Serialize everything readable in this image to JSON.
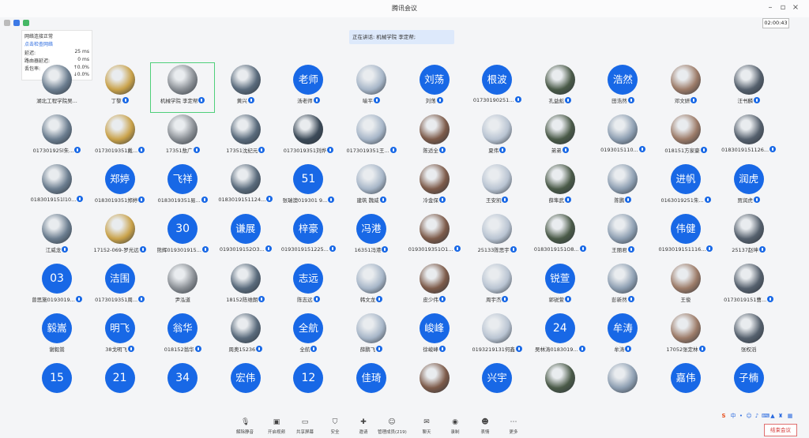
{
  "app": {
    "title": "腾讯会议"
  },
  "clock": "02:00:43",
  "speaking_banner": "正在讲话: 机械学院 李定帮;",
  "network": {
    "status": "网络连接正常",
    "check_link": "点击检查网络",
    "rows": [
      {
        "label": "延迟:",
        "value": "25 ms"
      },
      {
        "label": "路由器延迟:",
        "value": "0 ms"
      },
      {
        "label": "丢包率:",
        "value": "↑0.0%"
      },
      {
        "label": "",
        "value": "↓0.0%"
      }
    ]
  },
  "participants": [
    {
      "name": "湖北工程学院吴...",
      "avatar": "photo",
      "mic": false
    },
    {
      "name": "丁黎",
      "avatar": "photo",
      "mic": true
    },
    {
      "name": "机械学院 李定帮",
      "avatar": "photo",
      "mic": true,
      "active": true
    },
    {
      "name": "黄兴",
      "avatar": "photo",
      "mic": true
    },
    {
      "name": "汤老师",
      "avatar": "text",
      "text": "老师",
      "mic": true
    },
    {
      "name": "喻平",
      "avatar": "photo",
      "mic": true
    },
    {
      "name": "刘荡",
      "avatar": "text",
      "text": "刘荡",
      "mic": true
    },
    {
      "name": "01730190251...",
      "avatar": "text",
      "text": "根波",
      "mic": true
    },
    {
      "name": "孔益彪",
      "avatar": "photo",
      "mic": true
    },
    {
      "name": "田浩然",
      "avatar": "text",
      "text": "浩然",
      "mic": true
    },
    {
      "name": "邓文妍",
      "avatar": "photo",
      "mic": true
    },
    {
      "name": "汪书麟",
      "avatar": "photo",
      "mic": true
    },
    {
      "name": "017301925l朱...",
      "avatar": "photo",
      "mic": true
    },
    {
      "name": "0173019351戴...",
      "avatar": "photo",
      "mic": true
    },
    {
      "name": "17351敖广",
      "avatar": "photo",
      "mic": true
    },
    {
      "name": "17351沈纪元",
      "avatar": "photo",
      "mic": true
    },
    {
      "name": "0173019351刘烨",
      "avatar": "photo",
      "mic": true
    },
    {
      "name": "0173019351王...",
      "avatar": "photo",
      "mic": true
    },
    {
      "name": "陈适全",
      "avatar": "photo",
      "mic": true
    },
    {
      "name": "夏伟",
      "avatar": "photo",
      "mic": true
    },
    {
      "name": "弟弟",
      "avatar": "photo",
      "mic": true
    },
    {
      "name": "0193015110...",
      "avatar": "photo",
      "mic": true
    },
    {
      "name": "018151方家豪",
      "avatar": "photo",
      "mic": true
    },
    {
      "name": "0183019151126...",
      "avatar": "photo",
      "mic": true
    },
    {
      "name": "0183019151l10...",
      "avatar": "photo",
      "mic": true
    },
    {
      "name": "0183019351郑婷",
      "avatar": "text",
      "text": "郑婷",
      "mic": true
    },
    {
      "name": "0183019351易...",
      "avatar": "text",
      "text": "飞祥",
      "mic": true
    },
    {
      "name": "0183019151124...",
      "avatar": "photo",
      "mic": true
    },
    {
      "name": "张瑞澳019301 9...",
      "avatar": "text",
      "text": "51",
      "mic": true
    },
    {
      "name": "建筑 魏威",
      "avatar": "photo",
      "mic": true
    },
    {
      "name": "冷金保",
      "avatar": "photo",
      "mic": true
    },
    {
      "name": "王安凯",
      "avatar": "photo",
      "mic": true
    },
    {
      "name": "薛隼武",
      "avatar": "photo",
      "mic": true
    },
    {
      "name": "陈鹏",
      "avatar": "photo",
      "mic": true
    },
    {
      "name": "0163019251朱...",
      "avatar": "text",
      "text": "进帆",
      "mic": true
    },
    {
      "name": "贾润虎",
      "avatar": "text",
      "text": "润虎",
      "mic": true
    },
    {
      "name": "江威龙",
      "avatar": "photo",
      "mic": true
    },
    {
      "name": "17152-069-罗光远",
      "avatar": "photo",
      "mic": true
    },
    {
      "name": "熊辉019301915...",
      "avatar": "text",
      "text": "30",
      "mic": true
    },
    {
      "name": "0193019152O3...",
      "avatar": "text",
      "text": "谦展",
      "mic": true
    },
    {
      "name": "0193019151225...",
      "avatar": "text",
      "text": "梓豪",
      "mic": true
    },
    {
      "name": "16351冯港",
      "avatar": "text",
      "text": "冯港",
      "mic": true
    },
    {
      "name": "0193019351O1...",
      "avatar": "photo",
      "mic": true
    },
    {
      "name": "25133陈思宇",
      "avatar": "photo",
      "mic": true
    },
    {
      "name": "0183019151O8...",
      "avatar": "photo",
      "mic": true
    },
    {
      "name": "王丽君",
      "avatar": "photo",
      "mic": true
    },
    {
      "name": "0193019151116...",
      "avatar": "text",
      "text": "伟健",
      "mic": true
    },
    {
      "name": "25137赵坤",
      "avatar": "photo",
      "mic": true
    },
    {
      "name": "曾思施0193019...",
      "avatar": "text",
      "text": "03",
      "mic": true
    },
    {
      "name": "0173019351周...",
      "avatar": "text",
      "text": "洁围",
      "mic": true
    },
    {
      "name": "尹泓道",
      "avatar": "photo",
      "mic": false
    },
    {
      "name": "18152陈维朗",
      "avatar": "photo",
      "mic": true
    },
    {
      "name": "陈志远",
      "avatar": "text",
      "text": "志远",
      "mic": true
    },
    {
      "name": "韩文龙",
      "avatar": "photo",
      "mic": true
    },
    {
      "name": "皮少伟",
      "avatar": "photo",
      "mic": true
    },
    {
      "name": "周宇杰",
      "avatar": "photo",
      "mic": true
    },
    {
      "name": "郭锐萱",
      "avatar": "text",
      "text": "锐萱",
      "mic": true
    },
    {
      "name": "彭新然",
      "avatar": "photo",
      "mic": true
    },
    {
      "name": "王俊",
      "avatar": "photo",
      "mic": false
    },
    {
      "name": "0173019151曹...",
      "avatar": "photo",
      "mic": true
    },
    {
      "name": "谢毅嵩",
      "avatar": "text",
      "text": "毅嵩",
      "mic": false
    },
    {
      "name": "38戈明飞",
      "avatar": "text",
      "text": "明飞",
      "mic": true
    },
    {
      "name": "018152翁华",
      "avatar": "text",
      "text": "翁华",
      "mic": true
    },
    {
      "name": "周奥15236",
      "avatar": "photo",
      "mic": true
    },
    {
      "name": "全航",
      "avatar": "text",
      "text": "全航",
      "mic": true
    },
    {
      "name": "薛鹏飞",
      "avatar": "photo",
      "mic": true
    },
    {
      "name": "徐峻峰",
      "avatar": "text",
      "text": "峻峰",
      "mic": true
    },
    {
      "name": "0193219131何鑫",
      "avatar": "photo",
      "mic": true
    },
    {
      "name": "吴林涛0183019...",
      "avatar": "text",
      "text": "24",
      "mic": true
    },
    {
      "name": "牟涛",
      "avatar": "text",
      "text": "牟涛",
      "mic": true
    },
    {
      "name": "17052张定林",
      "avatar": "photo",
      "mic": true
    },
    {
      "name": "张权滔",
      "avatar": "photo",
      "mic": false
    },
    {
      "name": "",
      "avatar": "text",
      "text": "15",
      "mic": false
    },
    {
      "name": "",
      "avatar": "text",
      "text": "21",
      "mic": false
    },
    {
      "name": "",
      "avatar": "text",
      "text": "34",
      "mic": false
    },
    {
      "name": "",
      "avatar": "text",
      "text": "宏伟",
      "mic": false
    },
    {
      "name": "",
      "avatar": "text",
      "text": "12",
      "mic": false
    },
    {
      "name": "",
      "avatar": "text",
      "text": "佳琦",
      "mic": false
    },
    {
      "name": "",
      "avatar": "photo",
      "mic": false
    },
    {
      "name": "",
      "avatar": "text",
      "text": "兴宇",
      "mic": false
    },
    {
      "name": "",
      "avatar": "photo",
      "mic": false
    },
    {
      "name": "",
      "avatar": "photo",
      "mic": false
    },
    {
      "name": "",
      "avatar": "text",
      "text": "嘉伟",
      "mic": false
    },
    {
      "name": "",
      "avatar": "text",
      "text": "子楠",
      "mic": false
    }
  ],
  "toolbar": [
    {
      "id": "unmute",
      "label": "解除静音",
      "icon": "microphone-muted-icon",
      "glyph": "🎙"
    },
    {
      "id": "video",
      "label": "开启视频",
      "icon": "camera-off-icon",
      "glyph": "▣"
    },
    {
      "id": "share",
      "label": "共享屏幕",
      "icon": "share-screen-icon",
      "glyph": "▭"
    },
    {
      "id": "security",
      "label": "安全",
      "icon": "shield-icon",
      "glyph": "⛉"
    },
    {
      "id": "invite",
      "label": "邀请",
      "icon": "invite-icon",
      "glyph": "✚"
    },
    {
      "id": "members",
      "label": "管理成员(219)",
      "icon": "members-icon",
      "glyph": "☺"
    },
    {
      "id": "chat",
      "label": "聊天",
      "icon": "chat-icon",
      "glyph": "✉"
    },
    {
      "id": "record",
      "label": "录制",
      "icon": "record-icon",
      "glyph": "◉"
    },
    {
      "id": "emoji",
      "label": "表情",
      "icon": "emoji-icon",
      "glyph": "☻"
    },
    {
      "id": "more",
      "label": "更多",
      "icon": "more-icon",
      "glyph": "⋯"
    }
  ],
  "end_button": "结束会议",
  "colors": {
    "avatar_blue": "#1868e6",
    "active_outline": "#4fcf7a",
    "end_red": "#d12e2e"
  }
}
